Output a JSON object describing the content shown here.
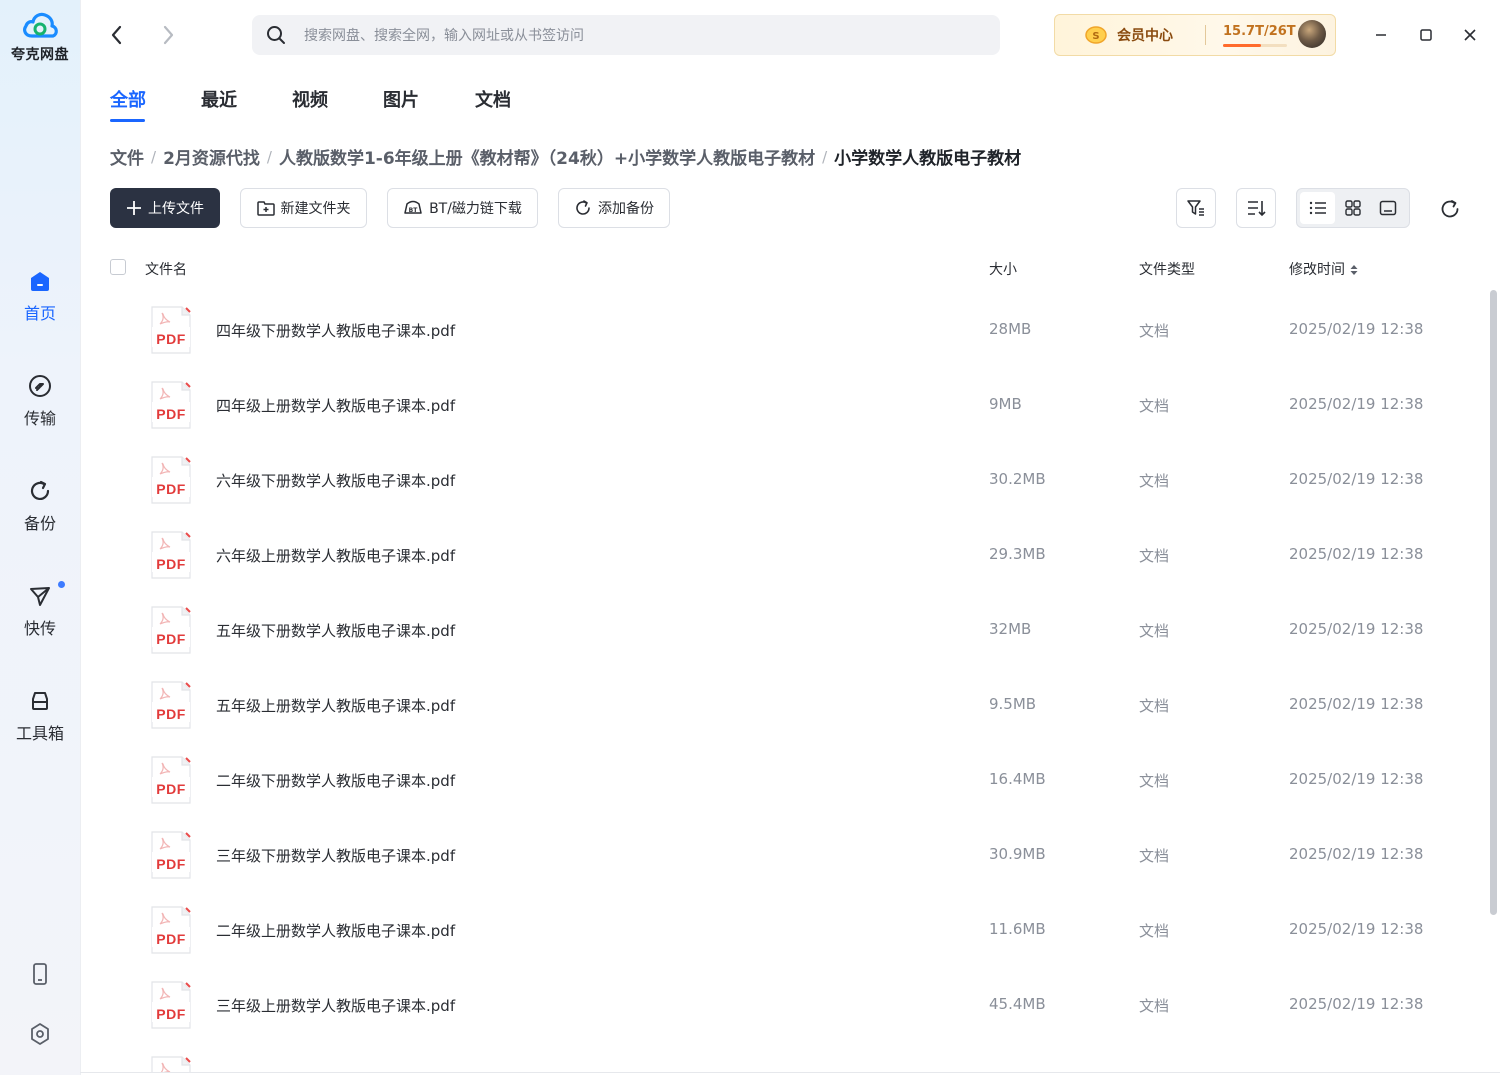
{
  "app": {
    "name": "夸克网盘",
    "brand_color": "#1a66ff"
  },
  "sidebar": {
    "items": [
      {
        "label": "首页",
        "icon": "home-icon",
        "active": true
      },
      {
        "label": "传输",
        "icon": "transfer-icon",
        "active": false
      },
      {
        "label": "备份",
        "icon": "backup-icon",
        "active": false
      },
      {
        "label": "快传",
        "icon": "quick-send-icon",
        "active": false,
        "has_dot": true
      },
      {
        "label": "工具箱",
        "icon": "toolbox-icon",
        "active": false
      }
    ],
    "bottom_icons": [
      "phone-icon",
      "settings-icon"
    ]
  },
  "search": {
    "placeholder": "搜索网盘、搜索全网，输入网址或从书签访问",
    "value": ""
  },
  "vip": {
    "label": "会员中心",
    "quota": "15.7T/26T",
    "quota_fraction": 0.6
  },
  "tabs": [
    {
      "label": "全部",
      "active": true
    },
    {
      "label": "最近",
      "active": false
    },
    {
      "label": "视频",
      "active": false
    },
    {
      "label": "图片",
      "active": false
    },
    {
      "label": "文档",
      "active": false
    }
  ],
  "breadcrumb": [
    "文件",
    "2月资源代找",
    "人教版数学1-6年级上册《教材帮》（24秋）+小学数学人教版电子教材",
    "小学数学人教版电子教材"
  ],
  "toolbar": {
    "upload": "上传文件",
    "new_folder": "新建文件夹",
    "bt_download": "BT/磁力链下载",
    "add_backup": "添加备份"
  },
  "list": {
    "headers": {
      "name": "文件名",
      "size": "大小",
      "type": "文件类型",
      "modified": "修改时间"
    },
    "icon_text": "PDF",
    "files": [
      {
        "name": "四年级下册数学人教版电子课本.pdf",
        "size": "28MB",
        "type": "文档",
        "modified": "2025/02/19 12:38"
      },
      {
        "name": "四年级上册数学人教版电子课本.pdf",
        "size": "9MB",
        "type": "文档",
        "modified": "2025/02/19 12:38"
      },
      {
        "name": "六年级下册数学人教版电子课本.pdf",
        "size": "30.2MB",
        "type": "文档",
        "modified": "2025/02/19 12:38"
      },
      {
        "name": "六年级上册数学人教版电子课本.pdf",
        "size": "29.3MB",
        "type": "文档",
        "modified": "2025/02/19 12:38"
      },
      {
        "name": "五年级下册数学人教版电子课本.pdf",
        "size": "32MB",
        "type": "文档",
        "modified": "2025/02/19 12:38"
      },
      {
        "name": "五年级上册数学人教版电子课本.pdf",
        "size": "9.5MB",
        "type": "文档",
        "modified": "2025/02/19 12:38"
      },
      {
        "name": "二年级下册数学人教版电子课本.pdf",
        "size": "16.4MB",
        "type": "文档",
        "modified": "2025/02/19 12:38"
      },
      {
        "name": "三年级下册数学人教版电子课本.pdf",
        "size": "30.9MB",
        "type": "文档",
        "modified": "2025/02/19 12:38"
      },
      {
        "name": "二年级上册数学人教版电子课本.pdf",
        "size": "11.6MB",
        "type": "文档",
        "modified": "2025/02/19 12:38"
      },
      {
        "name": "三年级上册数学人教版电子课本.pdf",
        "size": "45.4MB",
        "type": "文档",
        "modified": "2025/02/19 12:38"
      }
    ]
  }
}
